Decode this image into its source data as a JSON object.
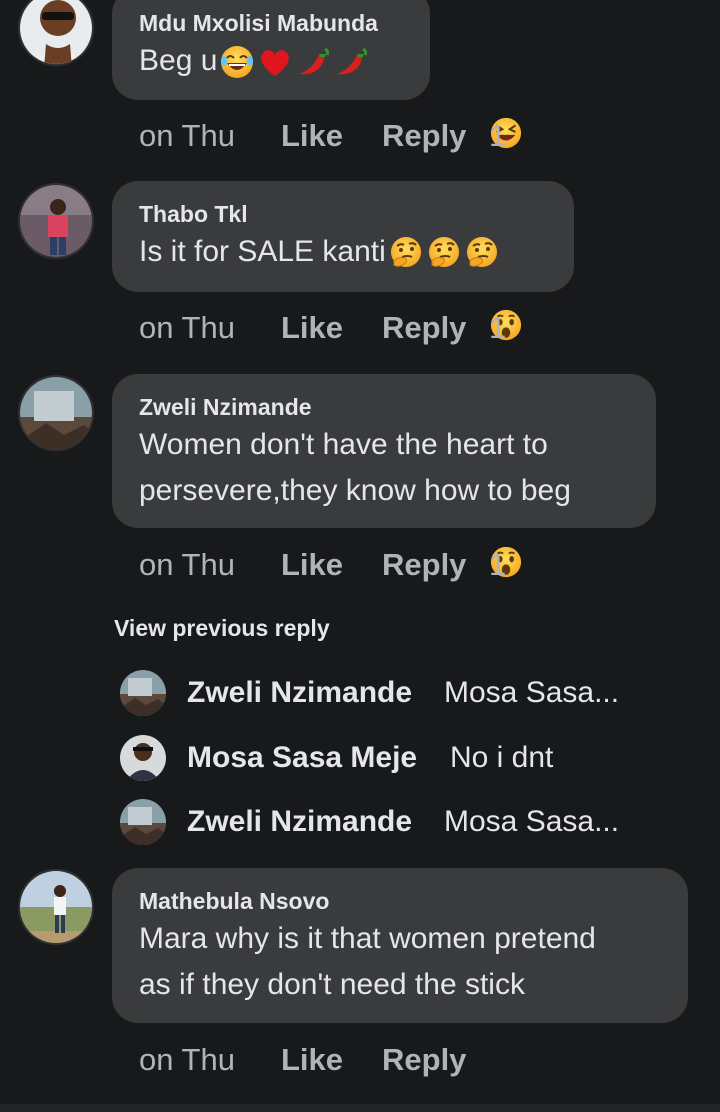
{
  "comments": [
    {
      "author": "Mdu Mxolisi Mabunda",
      "text": "Beg u",
      "emojis": [
        "laughing-tears",
        "heart",
        "chili",
        "chili"
      ],
      "time": "on Thu",
      "like": "Like",
      "reply": "Reply",
      "reaction": "laughing-squint",
      "reaction_count": "1"
    },
    {
      "author": "Thabo Tkl",
      "text": "Is it for SALE kanti",
      "emojis": [
        "thinking",
        "thinking",
        "thinking"
      ],
      "time": "on Thu",
      "like": "Like",
      "reply": "Reply",
      "reaction": "wow",
      "reaction_count": "1"
    },
    {
      "author": "Zweli Nzimande",
      "text_line1": "Women don't have the heart to",
      "text_line2": "persevere,they know how to beg",
      "time": "on Thu",
      "like": "Like",
      "reply": "Reply",
      "reaction": "wow",
      "reaction_count": "1"
    },
    {
      "author": "Mathebula Nsovo",
      "text_line1": "Mara why is it that women pretend",
      "text_line2": "as if they don't need the stick",
      "time": "on Thu",
      "like": "Like",
      "reply": "Reply"
    }
  ],
  "view_previous": "View previous reply",
  "replies": [
    {
      "name": "Zweli Nzimande",
      "text": "Mosa Sasa..."
    },
    {
      "name": "Mosa Sasa Meje",
      "text": "No i dnt"
    },
    {
      "name": "Zweli Nzimande",
      "text": "Mosa Sasa..."
    }
  ],
  "colors": {
    "background": "#18191a",
    "bubble": "#3a3b3c",
    "primary_text": "#e4e6eb",
    "secondary_text": "#b0b3b8",
    "reaction_yellow": "#f7b125"
  }
}
